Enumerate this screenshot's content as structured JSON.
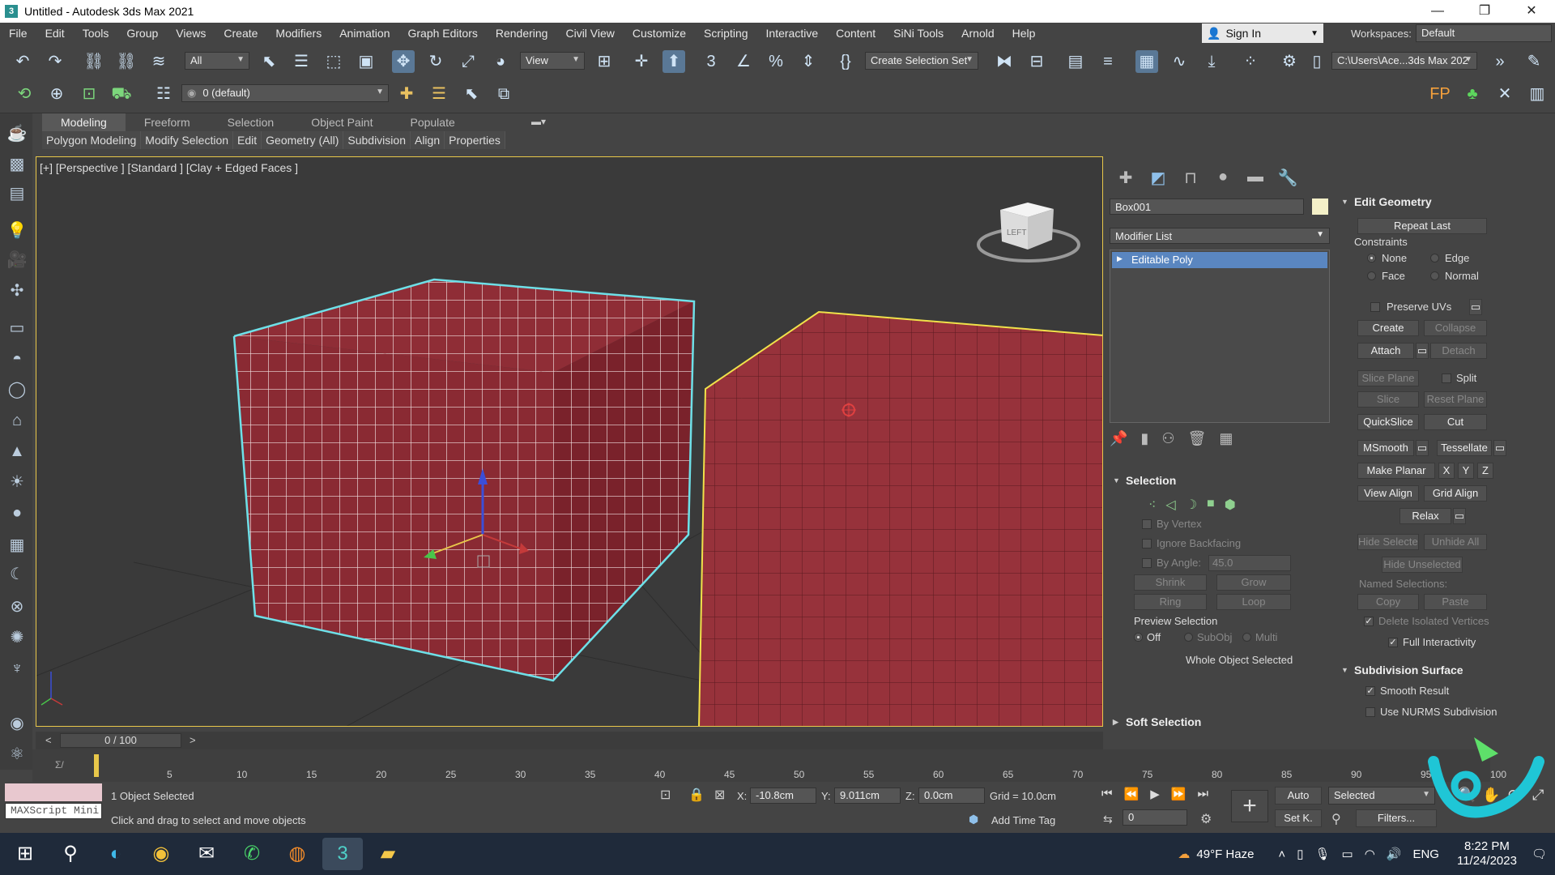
{
  "window": {
    "title": "Untitled - Autodesk 3ds Max 2021"
  },
  "menu": [
    "File",
    "Edit",
    "Tools",
    "Group",
    "Views",
    "Create",
    "Modifiers",
    "Animation",
    "Graph Editors",
    "Rendering",
    "Civil View",
    "Customize",
    "Scripting",
    "Interactive",
    "Content",
    "SiNi Tools",
    "Arnold",
    "Help"
  ],
  "signin": {
    "label": "Sign In"
  },
  "workspace": {
    "label": "Workspaces:",
    "value": "Default"
  },
  "toolbar": {
    "filter": "All",
    "refcoord": "View",
    "selset": "Create Selection Set",
    "path": "C:\\Users\\Ace...3ds Max 202",
    "layer": "0 (default)"
  },
  "ribbon": {
    "tabs": [
      "Modeling",
      "Freeform",
      "Selection",
      "Object Paint",
      "Populate"
    ],
    "subtabs": [
      "Polygon Modeling",
      "Modify Selection",
      "Edit",
      "Geometry (All)",
      "Subdivision",
      "Align",
      "Properties"
    ]
  },
  "viewport": {
    "label": "[+] [Perspective ] [Standard ] [Clay + Edged Faces ]",
    "viewcube_label": "LEFT"
  },
  "cmdpanel": {
    "object_name": "Box001",
    "object_color": "#f4f0c8",
    "modifier_list": "Modifier List",
    "stack_item": "Editable Poly",
    "selection": {
      "title": "Selection",
      "by_vertex": "By Vertex",
      "ignore_backfacing": "Ignore Backfacing",
      "by_angle": "By Angle:",
      "angle_value": "45.0",
      "shrink": "Shrink",
      "grow": "Grow",
      "ring": "Ring",
      "loop": "Loop",
      "preview": "Preview Selection",
      "off": "Off",
      "subobj": "SubObj",
      "multi": "Multi",
      "status": "Whole Object Selected"
    },
    "soft_selection": "Soft Selection",
    "edit_geometry": {
      "title": "Edit Geometry",
      "repeat_last": "Repeat Last",
      "constraints": "Constraints",
      "none": "None",
      "edge": "Edge",
      "face": "Face",
      "normal": "Normal",
      "preserve_uvs": "Preserve UVs",
      "create": "Create",
      "collapse": "Collapse",
      "attach": "Attach",
      "detach": "Detach",
      "slice_plane": "Slice Plane",
      "split": "Split",
      "slice": "Slice",
      "reset_plane": "Reset Plane",
      "quickslice": "QuickSlice",
      "cut": "Cut",
      "msmooth": "MSmooth",
      "tessellate": "Tessellate",
      "make_planar": "Make Planar",
      "x": "X",
      "y": "Y",
      "z": "Z",
      "view_align": "View Align",
      "grid_align": "Grid Align",
      "relax": "Relax",
      "hide_selected": "Hide Selected",
      "unhide_all": "Unhide All",
      "hide_unselected": "Hide Unselected",
      "named_selections": "Named Selections:",
      "copy": "Copy",
      "paste": "Paste",
      "delete_isolated": "Delete Isolated Vertices",
      "full_interactivity": "Full Interactivity"
    },
    "subdivision_surface": {
      "title": "Subdivision Surface",
      "smooth_result": "Smooth Result",
      "use_nurms": "Use NURMS Subdivision"
    }
  },
  "timeline": {
    "frame": "0 / 100",
    "ticks": [
      "0",
      "5",
      "10",
      "15",
      "20",
      "25",
      "30",
      "35",
      "40",
      "45",
      "50",
      "55",
      "60",
      "65",
      "70",
      "75",
      "80",
      "85",
      "90",
      "95",
      "100"
    ]
  },
  "status": {
    "maxscript": "MAXScript Mini",
    "selected_count": "1 Object Selected",
    "prompt": "Click and drag to select and move objects",
    "x_label": "X:",
    "x_value": "-10.8cm",
    "y_label": "Y:",
    "y_value": "9.011cm",
    "z_label": "Z:",
    "z_value": "0.0cm",
    "grid": "Grid = 10.0cm",
    "add_time_tag": "Add Time Tag",
    "auto": "Auto",
    "set_key": "Set K.",
    "key_filter": "Selected",
    "filters": "Filters...",
    "frame_field": "0"
  },
  "taskbar": {
    "weather": "49°F Haze",
    "lang": "ENG",
    "time": "8:22 PM",
    "date": "11/24/2023"
  }
}
